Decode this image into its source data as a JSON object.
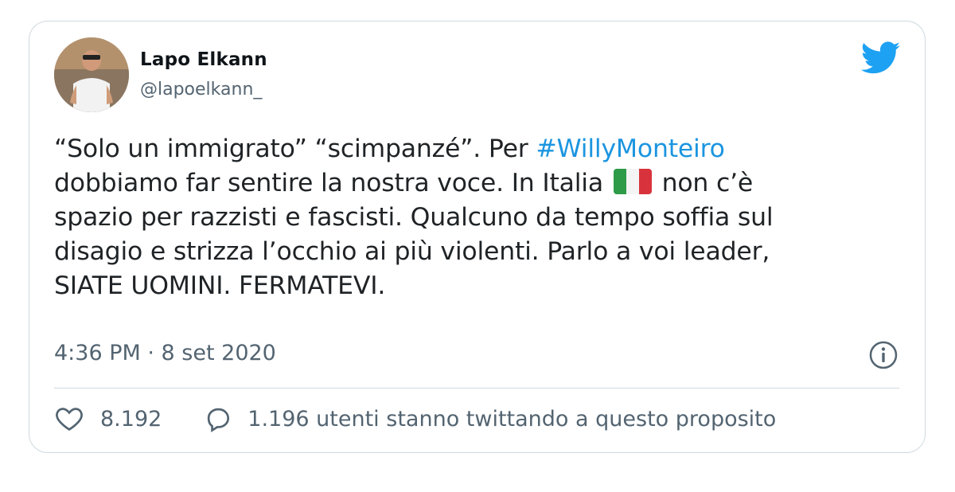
{
  "tweet": {
    "author_name": "Lapo Elkann",
    "author_handle": "@lapoelkann_",
    "text_part1": "“Solo un immigrato” “scimpanzé”. Per ",
    "hashtag": "#WillyMonteiro",
    "text_part2": "dobbiamo far sentire la nostra voce. In Italia ",
    "text_part3": " non c’è",
    "text_part4": "spazio per razzisti e fascisti. Qualcuno da tempo soffia sul",
    "text_part5": "disagio e strizza l’occhio ai più violenti. Parlo a voi leader,",
    "text_part6": "SIATE UOMINI. FERMATEVI.",
    "flag_emoji": "italy-flag",
    "timestamp": "4:36 PM · 8 set 2020",
    "like_count": "8.192",
    "reply_text": "1.196 utenti stanno twittando a questo proposito"
  },
  "colors": {
    "twitter_blue": "#1da1f2",
    "hashtag": "#1b95e0",
    "secondary_text": "#536471",
    "border": "#cfd9de"
  },
  "icons": {
    "brand": "twitter-bird-icon",
    "info": "info-icon",
    "like": "heart-icon",
    "reply": "speech-bubble-icon"
  }
}
